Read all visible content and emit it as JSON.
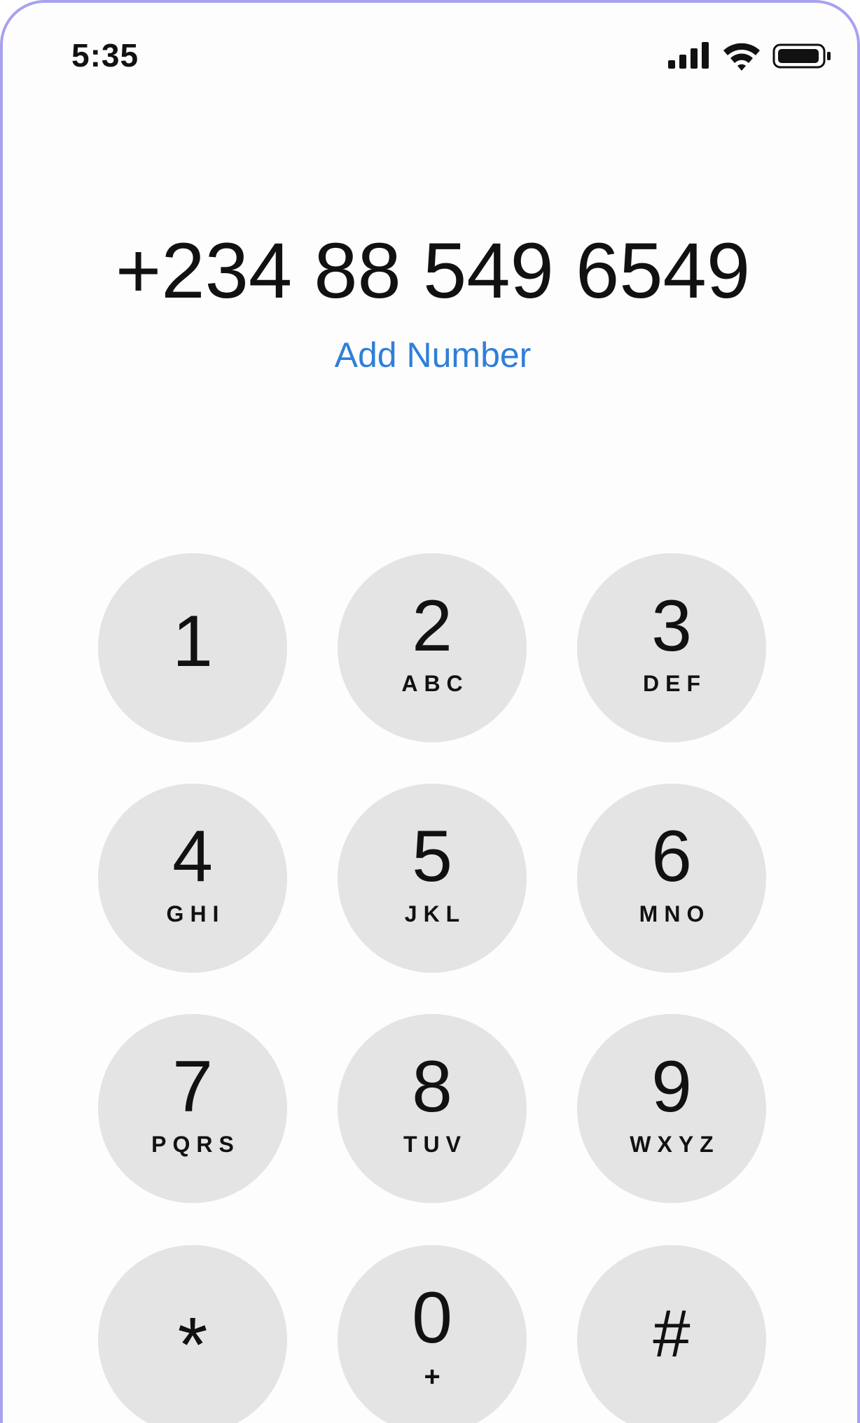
{
  "status_bar": {
    "time": "5:35",
    "icons": [
      "signal-icon",
      "wifi-icon",
      "battery-icon"
    ]
  },
  "dialer": {
    "number": "+234 88 549 6549",
    "add_number_label": "Add Number"
  },
  "keypad": [
    {
      "digit": "1",
      "letters": ""
    },
    {
      "digit": "2",
      "letters": "ABC"
    },
    {
      "digit": "3",
      "letters": "DEF"
    },
    {
      "digit": "4",
      "letters": "GHI"
    },
    {
      "digit": "5",
      "letters": "JKL"
    },
    {
      "digit": "6",
      "letters": "MNO"
    },
    {
      "digit": "7",
      "letters": "PQRS"
    },
    {
      "digit": "8",
      "letters": "TUV"
    },
    {
      "digit": "9",
      "letters": "WXYZ"
    },
    {
      "digit": "*",
      "letters": ""
    },
    {
      "digit": "0",
      "letters": "+"
    },
    {
      "digit": "#",
      "letters": ""
    }
  ],
  "colors": {
    "accent": "#2f7fd8",
    "key_background": "#e4e4e4",
    "frame_border": "#a8a1f0"
  }
}
